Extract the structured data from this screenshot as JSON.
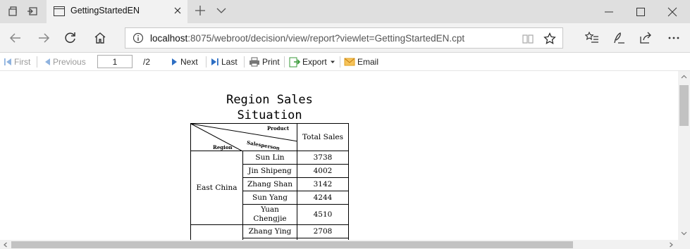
{
  "browser": {
    "tab_title": "GettingStartedEN",
    "url_host": "localhost",
    "url_rest": ":8075/webroot/decision/view/report?viewlet=GettingStartedEN.cpt"
  },
  "toolbar": {
    "first": "First",
    "previous": "Previous",
    "page_value": "1",
    "page_total": "/2",
    "next": "Next",
    "last": "Last",
    "print": "Print",
    "export": "Export",
    "email": "Email"
  },
  "report": {
    "title_line1": "Region Sales",
    "title_line2": "Situation",
    "header_product": "Product",
    "header_salesperson": "Salesperson",
    "header_region": "Region",
    "header_total": "Total Sales",
    "region_east": "East China",
    "rows": [
      {
        "name": "Sun Lin",
        "total": "3738"
      },
      {
        "name": "Jin Shipeng",
        "total": "4002"
      },
      {
        "name": "Zhang Shan",
        "total": "3142"
      },
      {
        "name": "Sun Yang",
        "total": "4244"
      },
      {
        "name": "Yuan Chengjie",
        "total": "4510"
      },
      {
        "name": "Zhang Ying",
        "total": "2708"
      }
    ]
  },
  "colors": {
    "accent_blue": "#2e6fc4",
    "export_green": "#3a9a3a",
    "email_orange": "#e0a020"
  }
}
